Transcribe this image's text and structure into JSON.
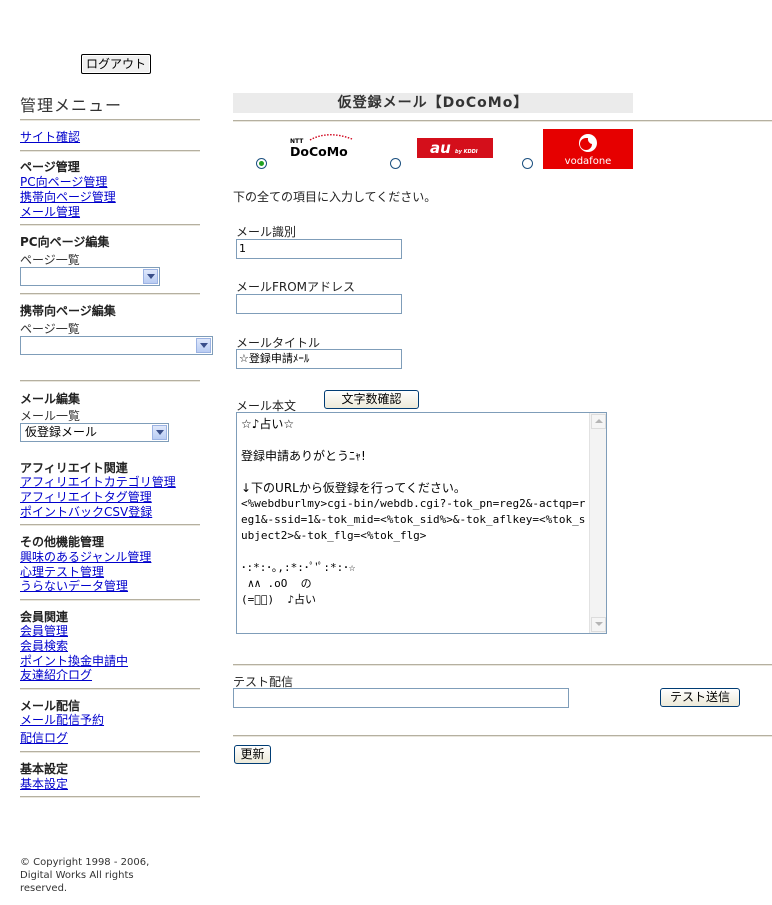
{
  "header": {
    "logout_label": "ログアウト"
  },
  "sidebar": {
    "title": "管理メニュー",
    "site_link": "サイト確認",
    "page_mgmt": {
      "heading": "ページ管理",
      "links": [
        "PC向ページ管理",
        "携帯向ページ管理",
        "メール管理"
      ]
    },
    "pc_edit": {
      "heading": "PC向ページ編集",
      "sub": "ページ一覧",
      "select_value": ""
    },
    "mobile_edit": {
      "heading": "携帯向ページ編集",
      "sub": "ページ一覧",
      "select_value": ""
    },
    "mail_edit": {
      "heading": "メール編集",
      "sub": "メール一覧",
      "select_value": "仮登録メール"
    },
    "affiliate": {
      "heading": "アフィリエイト関連",
      "links": [
        "アフィリエイトカテゴリ管理",
        "アフィリエイトタグ管理",
        "ポイントバックCSV登録"
      ]
    },
    "other": {
      "heading": "その他機能管理",
      "links": [
        "興味のあるジャンル管理",
        "心理テスト管理",
        "うらないデータ管理"
      ]
    },
    "member": {
      "heading": "会員関連",
      "links": [
        "会員管理",
        "会員検索",
        "ポイント換金申請中",
        "友達紹介ログ"
      ]
    },
    "delivery": {
      "heading": "メール配信",
      "links": [
        "メール配信予約",
        "配信ログ"
      ]
    },
    "basic": {
      "heading": "基本設定",
      "links": [
        "基本設定"
      ]
    },
    "copyright": "© Copyright 1998 - 2006, Digital Works All rights reserved."
  },
  "main": {
    "title": "仮登録メール【DoCoMo】",
    "carriers": {
      "docomo_ntt": "NTT",
      "docomo": "DoCoMo",
      "au": "au",
      "au_sub": "by KDDI",
      "vodafone": "vodafone",
      "selected": "DoCoMo"
    },
    "instruction": "下の全ての項目に入力してください。",
    "fields": {
      "mail_id_label": "メール識別",
      "mail_id_value": "1",
      "from_label": "メールFROMアドレス",
      "from_value": "",
      "subject_label": "メールタイトル",
      "subject_value": "☆登録申請ﾒｰﾙ",
      "body_label": "メール本文",
      "count_button": "文字数確認",
      "body_lines": [
        "☆♪占い☆",
        "",
        "登録申請ありがとうﾆｬ!",
        "",
        "↓下のURLから仮登録を行ってください。"
      ],
      "body_url": "<%webdburlmy>cgi-bin/webdb.cgi?-tok_pn=reg2&-actqp=reg1&-ssid=1&-tok_mid=<%tok_sid%>&-tok_aflkey=<%tok_subject2>&-tok_flg=<%tok_flg>",
      "body_footer": [
        "･:*:･｡,:*:･ﾟ'ﾟ:*:･☆",
        " ∧∧ .oO  の",
        "(=ﾟﾟ)  ♪占い"
      ]
    },
    "test": {
      "label": "テスト配信",
      "value": "",
      "button": "テスト送信"
    },
    "update_button": "更新"
  }
}
